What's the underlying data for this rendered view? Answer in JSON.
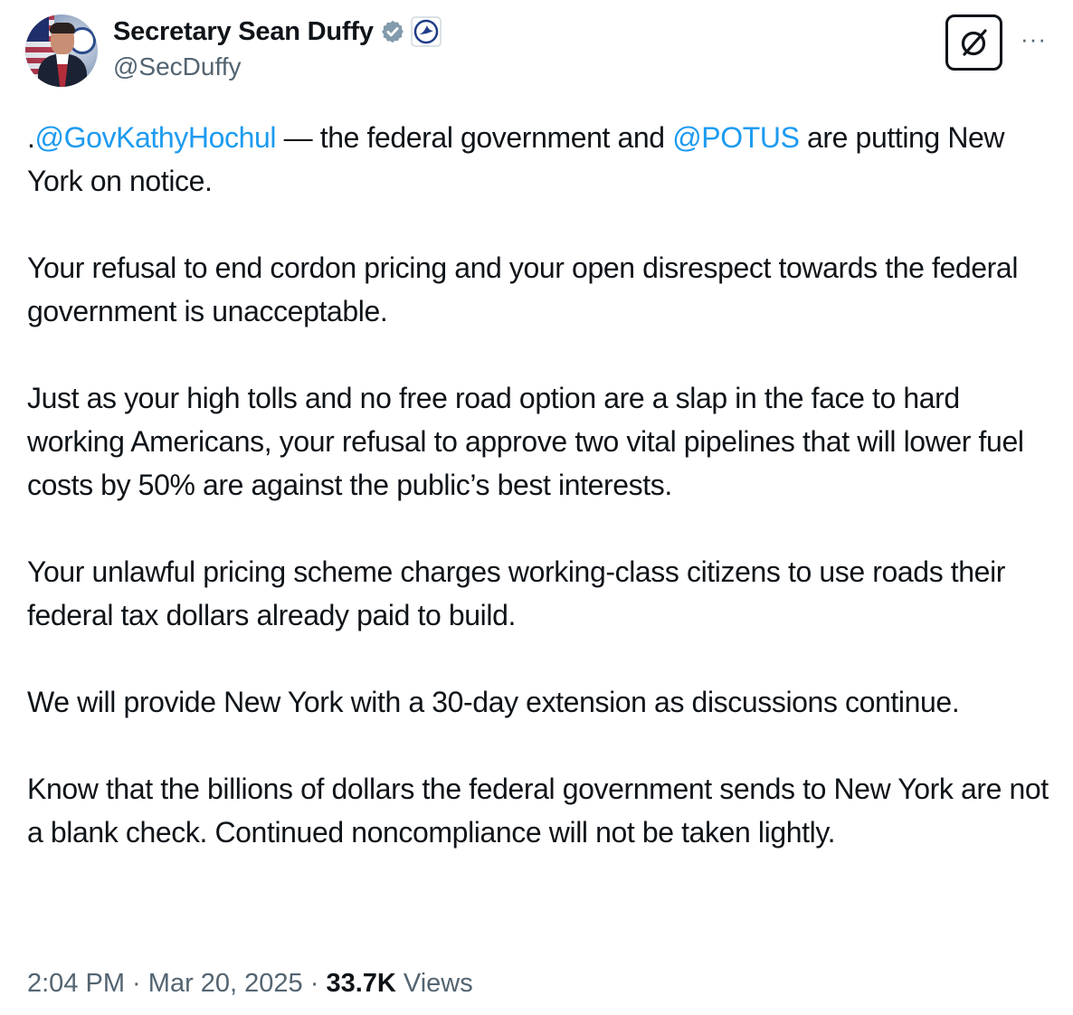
{
  "author": {
    "display_name": "Secretary Sean Duffy",
    "handle": "@SecDuffy",
    "verified_badge_color": "#829aab",
    "affiliation_icon": "us-department-of-transportation-icon"
  },
  "toolbar": {
    "grok_icon": "grok-icon",
    "more_label": "···"
  },
  "tweet": {
    "line1_prefix": ".",
    "mention_1": "@GovKathyHochul",
    "line1_mid": " — the federal government and ",
    "mention_2": "@POTUS",
    "line1_suffix": " are putting New York on notice.",
    "paragraph_2": "Your refusal to end cordon pricing and your open disrespect towards the federal government is unacceptable.",
    "paragraph_3": "Just as your high tolls and no free road option are a slap in the face to hard working Americans, your refusal to approve two vital pipelines that will lower fuel costs by 50% are against the public’s best interests.",
    "paragraph_4": "Your unlawful pricing scheme charges working-class citizens to use roads their federal tax dollars already paid to build.",
    "paragraph_5": "We will provide New York with a 30-day extension as discussions continue.",
    "paragraph_6": "Know that the billions of dollars the federal government sends to New York are not a blank check. Continued noncompliance will not be taken lightly."
  },
  "meta": {
    "time": "2:04 PM",
    "separator": " · ",
    "date": "Mar 20, 2025",
    "views_count": "33.7K",
    "views_label": " Views"
  },
  "colors": {
    "link": "#1d9bf0",
    "text": "#0f1419",
    "secondary": "#536471"
  }
}
